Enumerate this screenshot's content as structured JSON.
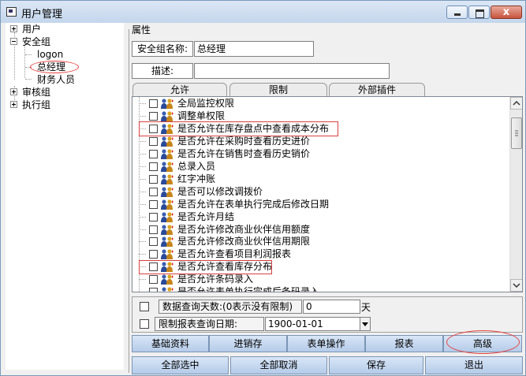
{
  "window": {
    "title": "用户管理",
    "icon": "app-window-icon",
    "controls": [
      "minimize-icon",
      "maximize-icon",
      "close-icon"
    ],
    "close_glyph": "x"
  },
  "tree": {
    "items": [
      {
        "label": "用户",
        "expander": "+"
      },
      {
        "label": "安全组",
        "expander": "-"
      },
      {
        "label": "logon"
      },
      {
        "label": "总经理",
        "selected": true
      },
      {
        "label": "财务人员"
      },
      {
        "label": "审核组",
        "expander": "+"
      },
      {
        "label": "执行组",
        "expander": "+"
      }
    ]
  },
  "properties": {
    "section_label": "属性",
    "name_label": "安全组名称:",
    "name_value": "总经理",
    "desc_label": "描述:",
    "desc_value": ""
  },
  "tabs": [
    {
      "label": "允许",
      "active": true
    },
    {
      "label": "限制",
      "active": false
    },
    {
      "label": "外部插件",
      "active": false
    }
  ],
  "permissions": [
    {
      "label": "全局监控权限",
      "checked": false
    },
    {
      "label": "调整单权限",
      "checked": false
    },
    {
      "label": "是否允许在库存盘点中查看成本分布",
      "checked": false,
      "highlighted": true
    },
    {
      "label": "是否允许在采购时查看历史进价",
      "checked": false
    },
    {
      "label": "是否允许在销售时查看历史销价",
      "checked": false
    },
    {
      "label": "总录入员",
      "checked": false
    },
    {
      "label": "红字冲账",
      "checked": false
    },
    {
      "label": "是否可以修改调拨价",
      "checked": false
    },
    {
      "label": "是否允许在表单执行完成后修改日期",
      "checked": false
    },
    {
      "label": "是否允许月结",
      "checked": false
    },
    {
      "label": "是否允许修改商业伙伴信用额度",
      "checked": false
    },
    {
      "label": "是否允许修改商业伙伴信用期限",
      "checked": false
    },
    {
      "label": "是否允许查看项目利润报表",
      "checked": false
    },
    {
      "label": "是否允许查看库存分布",
      "checked": false,
      "highlighted": true
    },
    {
      "label": "是否允许条码录入",
      "checked": false
    },
    {
      "label": "是否允许表单执行完成后条码录入",
      "checked": false
    }
  ],
  "options": {
    "query_days_label": "数据查询天数:(0表示没有限制)",
    "query_days_value": "0",
    "query_days_unit": "天",
    "report_date_label": "限制报表查询日期:",
    "report_date_value": "1900-01-01"
  },
  "category_buttons": [
    "基础资料",
    "进销存",
    "表单操作",
    "报表",
    "高级"
  ],
  "action_buttons": [
    "全部选中",
    "全部取消",
    "保存",
    "退出"
  ],
  "colors": {
    "accent_red": "#e84040",
    "button_blue": "#b5cbe8"
  }
}
